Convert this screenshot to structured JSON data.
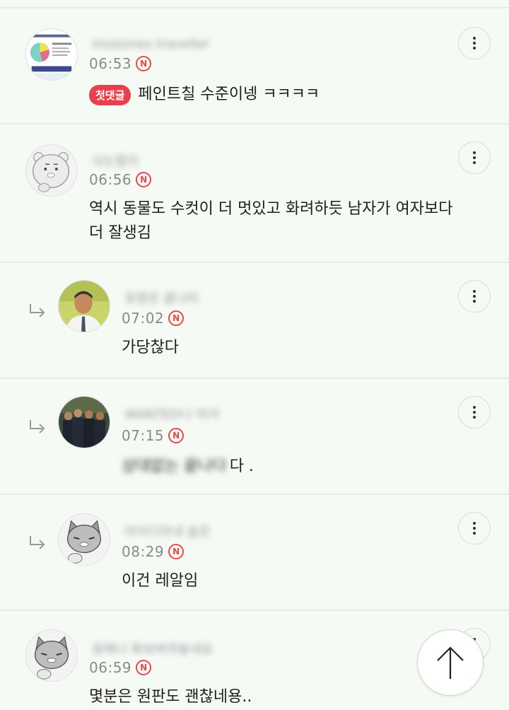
{
  "comments": [
    {
      "nickname": "insstones traveller",
      "time": "06:53",
      "new_badge": "N",
      "first_badge": "첫댓글",
      "text": "페인트칠 수준이넹 ㅋㅋㅋㅋ",
      "avatar_icon": "infographic-avatar-icon"
    },
    {
      "nickname": "사는말이",
      "time": "06:56",
      "new_badge": "N",
      "text_line1": "역시 동물도 수컷이 더 멋있고 화려하듯 남자가 여자보다",
      "text_line2": "더 잘생김",
      "avatar_icon": "ryan-character-avatar-icon"
    },
    {
      "nickname": "유령은 끝나리",
      "time": "07:02",
      "new_badge": "N",
      "text": "가당찮다",
      "avatar_icon": "man-photo-avatar-icon"
    },
    {
      "nickname": "WANTED니 어서",
      "time": "07:15",
      "new_badge": "N",
      "text_blurred": "상대없는 끝나다",
      "text_tail": "다 .",
      "avatar_icon": "group-photo-avatar-icon"
    },
    {
      "nickname": "아이디아내 숨은",
      "time": "08:29",
      "new_badge": "N",
      "text": "이건 레알임",
      "avatar_icon": "cat-character-avatar-icon"
    },
    {
      "nickname": "원래나 화보버려놓네요",
      "time": "06:59",
      "new_badge": "N",
      "text": "몇분은 원판도 괜찮네용..",
      "avatar_icon": "cat-character-avatar-icon"
    }
  ],
  "icons": {
    "more": "more-vertical-icon",
    "reply": "reply-arrow-icon",
    "scroll_top": "arrow-up-icon"
  },
  "colors": {
    "background": "#f6faf5",
    "accent_red": "#e8404c",
    "new_badge": "#e44b4b"
  }
}
